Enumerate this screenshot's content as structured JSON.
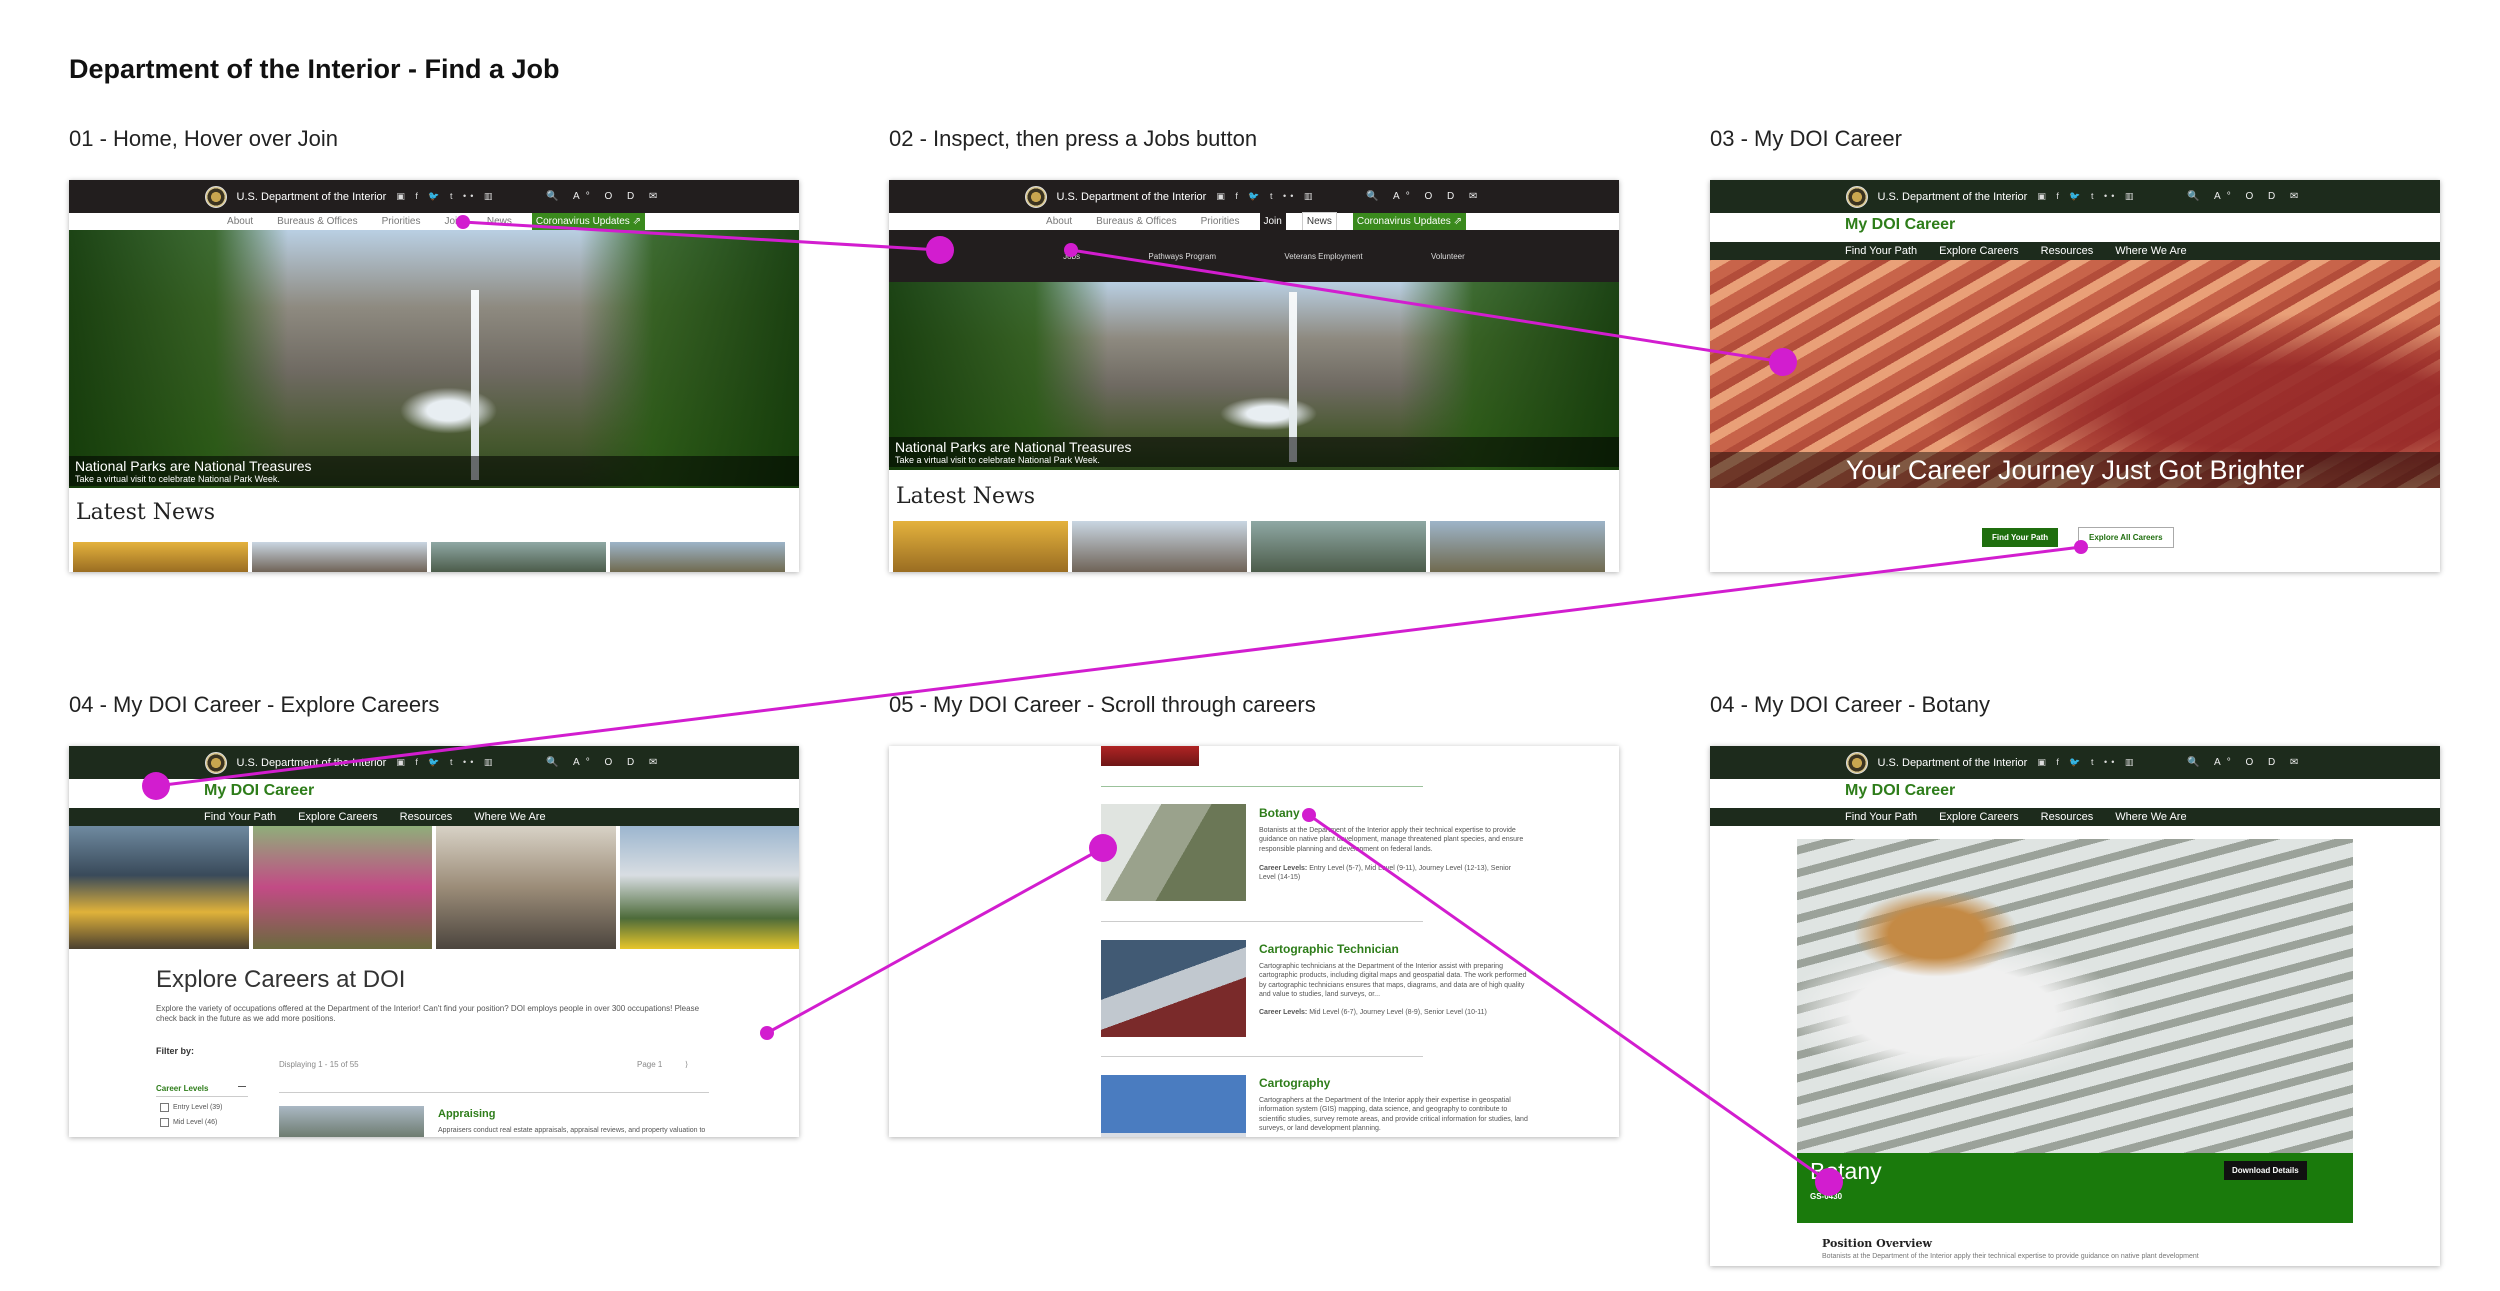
{
  "page_title": "Department of the Interior - Find a Job",
  "frames": {
    "f1": {
      "caption": "01 - Home, Hover over Join",
      "doi_name": "U.S. Department of the Interior",
      "social": "▣ f 🐦 t •• ▥",
      "tools": "🔍 A° O D ✉",
      "nav": [
        "About",
        "Bureaus & Offices",
        "Priorities",
        "Join",
        "News",
        "Coronavirus Updates ⇗"
      ],
      "hero_caption": "National Parks are National Treasures",
      "hero_sub": "Take a virtual visit to celebrate National Park Week.",
      "news_title": "Latest News"
    },
    "f2": {
      "caption": "02 - Inspect, then press a Jobs button",
      "doi_name": "U.S. Department of the Interior",
      "social": "▣ f 🐦 t •• ▥",
      "tools": "🔍 A° O D ✉",
      "nav": [
        "About",
        "Bureaus & Offices",
        "Priorities",
        "Join",
        "News",
        "Coronavirus Updates ⇗"
      ],
      "menu": [
        "Jobs",
        "Pathways Program",
        "Veterans Employment",
        "Volunteer"
      ],
      "hero_caption": "National Parks are National Treasures",
      "hero_sub": "Take a virtual visit to celebrate National Park Week.",
      "news_title": "Latest News"
    },
    "f3": {
      "caption": "03 - My DOI Career",
      "doi_name": "U.S. Department of the Interior",
      "social": "▣ f 🐦 t •• ▥",
      "tools": "🔍 A° O D ✉",
      "site_title": "My DOI Career",
      "nav": [
        "Find Your Path",
        "Explore Careers",
        "Resources",
        "Where We Are"
      ],
      "headline": "Your Career Journey Just Got Brighter",
      "btn_primary": "Find Your Path",
      "btn_secondary": "Explore All Careers"
    },
    "f4": {
      "caption": "04 - My DOI Career - Explore Careers",
      "doi_name": "U.S. Department of the Interior",
      "social": "▣ f 🐦 t •• ▥",
      "tools": "🔍 A° O D ✉",
      "site_title": "My DOI Career",
      "nav": [
        "Find Your Path",
        "Explore Careers",
        "Resources",
        "Where We Are"
      ],
      "heading": "Explore Careers at DOI",
      "desc": "Explore the variety of occupations offered at the Department of the Interior! Can't find your position? DOI employs people in over 300 occupations! Please check back in the future as we add more positions.",
      "filter_label": "Filter by:",
      "displaying": "Displaying 1 - 15 of 55",
      "page_label": "Page 1",
      "page_next": "⟩",
      "career_levels": "Career Levels",
      "collapse": "—",
      "check1": "Entry Level (39)",
      "check2": "Mid Level (46)",
      "first_career": "Appraising",
      "first_career_desc": "Appraisers conduct real estate appraisals, appraisal reviews, and property valuation to"
    },
    "f5": {
      "caption": "05 - My DOI Career - Scroll through careers",
      "items": [
        {
          "title": "Botany",
          "desc": "Botanists at the Department of the Interior apply their technical expertise to provide guidance on native plant development, manage threatened plant species, and ensure responsible planning and development on federal lands.",
          "levels_label": "Career Levels:",
          "levels": "Entry Level (5-7), Mid Level (9-11), Journey Level (12-13), Senior Level (14-15)"
        },
        {
          "title": "Cartographic Technician",
          "desc": "Cartographic technicians at the Department of the Interior assist with preparing cartographic products, including digital maps and geospatial data. The work performed by cartographic technicians ensures that maps, diagrams, and data are of high quality and value to studies, land surveys, or...",
          "levels_label": "Career Levels:",
          "levels": "Mid Level (6-7), Journey Level (8-9), Senior Level (10-11)"
        },
        {
          "title": "Cartography",
          "desc": "Cartographers at the Department of the Interior apply their expertise in geospatial information system (GIS) mapping, data science, and geography to contribute to scientific studies, survey remote areas, and provide critical information for studies, land surveys, or land development planning.",
          "levels_label": "",
          "levels": ""
        }
      ]
    },
    "f6": {
      "caption": "04 - My DOI Career - Botany",
      "doi_name": "U.S. Department of the Interior",
      "social": "▣ f 🐦 t •• ▥",
      "tools": "🔍 A° O D ✉",
      "site_title": "My DOI Career",
      "nav": [
        "Find Your Path",
        "Explore Careers",
        "Resources",
        "Where We Are"
      ],
      "career_name": "Botany",
      "career_code": "GS-0430",
      "download": "Download Details",
      "overview_title": "Position Overview",
      "overview_text": "Botanists at the Department of the Interior apply their technical expertise to provide guidance on native plant development"
    }
  },
  "connector_color": "#d21dcf",
  "colors": {
    "doi_dark": "#221e1e",
    "career_green": "#2e7d1a",
    "career_nav": "#1d2b1c",
    "covid_green": "#3a8a1d"
  }
}
